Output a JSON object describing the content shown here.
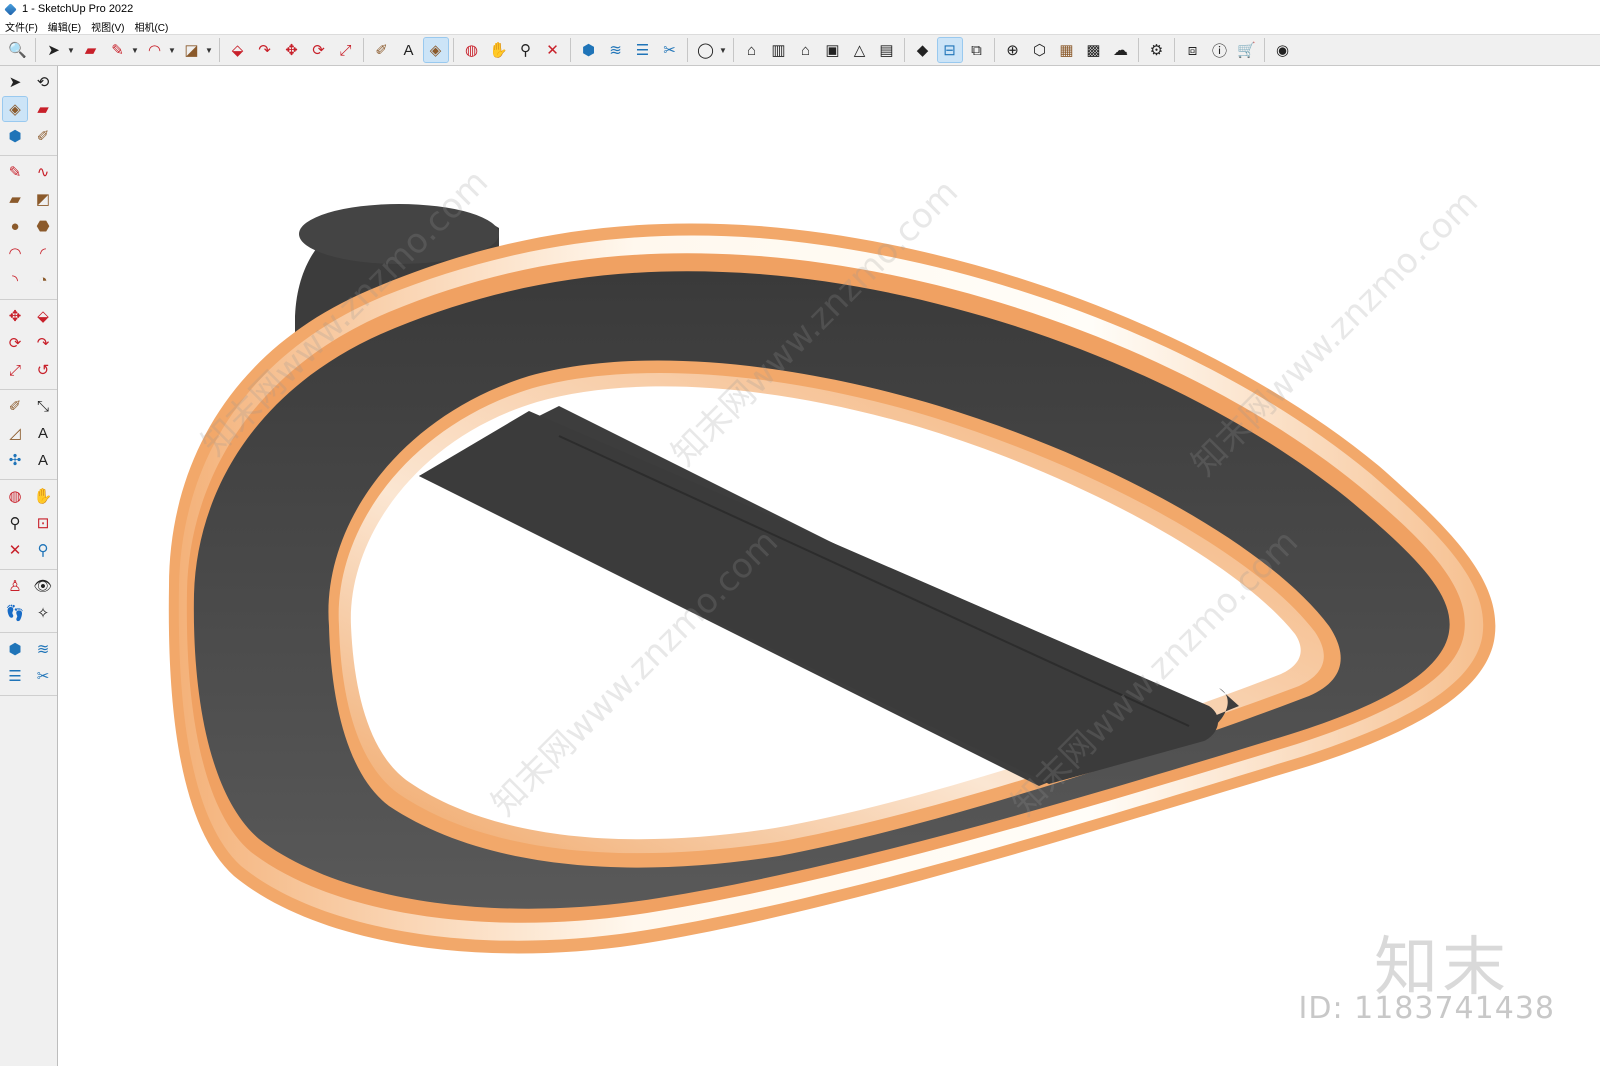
{
  "window": {
    "title": "1 - SketchUp Pro 2022"
  },
  "menu": [
    "文件(F)",
    "编辑(E)",
    "视图(V)",
    "相机(C)"
  ],
  "toolbar_icons": [
    "zoom-icon",
    "select-icon",
    "eraser-icon",
    "line-icon",
    "arc-icon",
    "shape-icon",
    "push-pull-icon",
    "follow-me-icon",
    "move-icon",
    "rotate-icon",
    "scale-icon",
    "tape-measure-icon",
    "text-icon",
    "paint-bucket-icon",
    "orbit-icon",
    "pan-icon",
    "zoom-window-icon",
    "zoom-extents-icon",
    "warehouse-icon",
    "sandbox-icon",
    "layers-icon",
    "scenes-icon",
    "account-icon",
    "house-icon",
    "building-icon",
    "home-icon",
    "box-icon",
    "home-outline-icon",
    "garage-icon",
    "solid-tools-icon",
    "outer-shell-icon",
    "intersect-icon",
    "add-location-icon",
    "styles-icon",
    "materials-icon",
    "xray-icon",
    "cloud-icon",
    "settings-icon",
    "section-icon",
    "info-icon",
    "cart-icon",
    "user-icon"
  ],
  "watermark": {
    "logo": "知末",
    "id": "ID: 1183741438",
    "diagonal": "知末网www.znzmo.com"
  },
  "model": {
    "body_color": "#4a4a4a",
    "rim_color": "#f2a86a",
    "glow_color": "#fff6e8",
    "bar_color": "#3d3d3d"
  }
}
